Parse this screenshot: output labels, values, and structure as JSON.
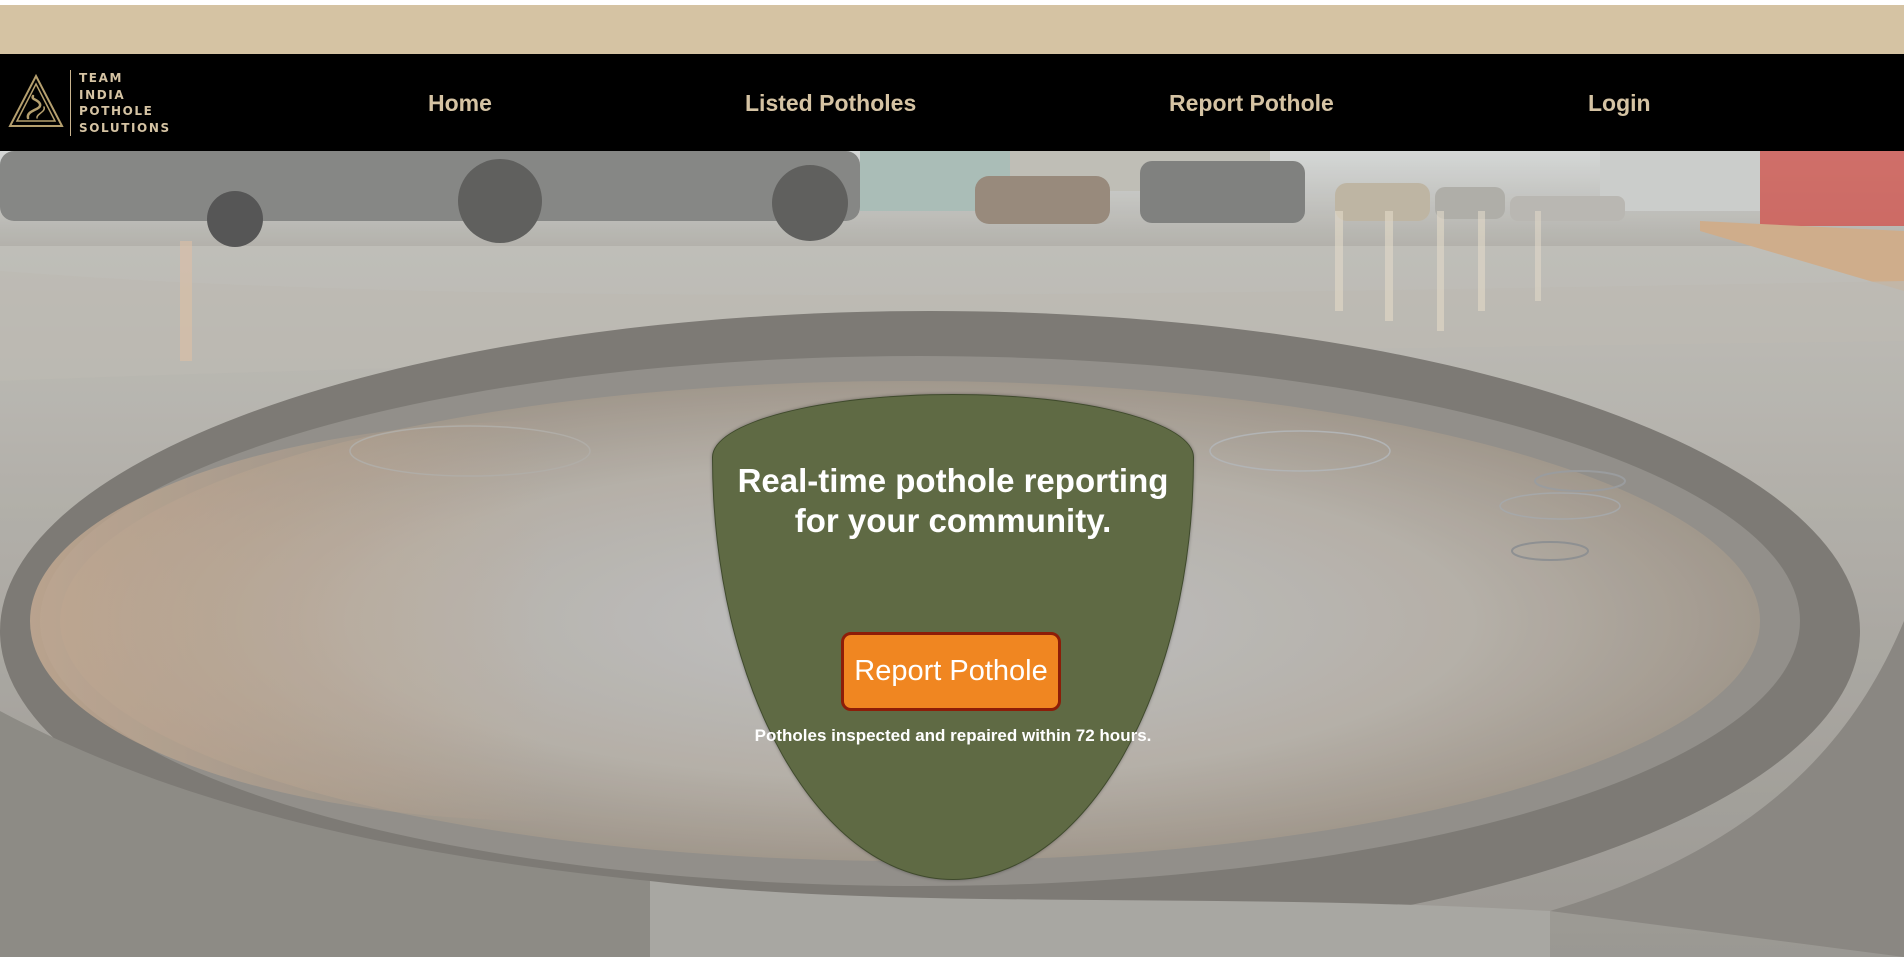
{
  "brand": {
    "logo_lines": [
      "TEAM",
      "INDIA",
      "POTHOLE",
      "SOLUTIONS"
    ]
  },
  "nav": {
    "items": [
      {
        "label": "Home"
      },
      {
        "label": "Listed Potholes"
      },
      {
        "label": "Report Pothole"
      },
      {
        "label": "Login"
      }
    ]
  },
  "hero": {
    "headline": "Real-time pothole reporting for your community.",
    "button_label": "Report Pothole",
    "note": "Potholes inspected and repaired within 72 hours."
  },
  "colors": {
    "top_band": "#d5c3a3",
    "navbar": "#000000",
    "nav_text": "#d5c3a3",
    "card": "#5f6a44",
    "button": "#f08621",
    "button_border": "#8d1d08"
  }
}
